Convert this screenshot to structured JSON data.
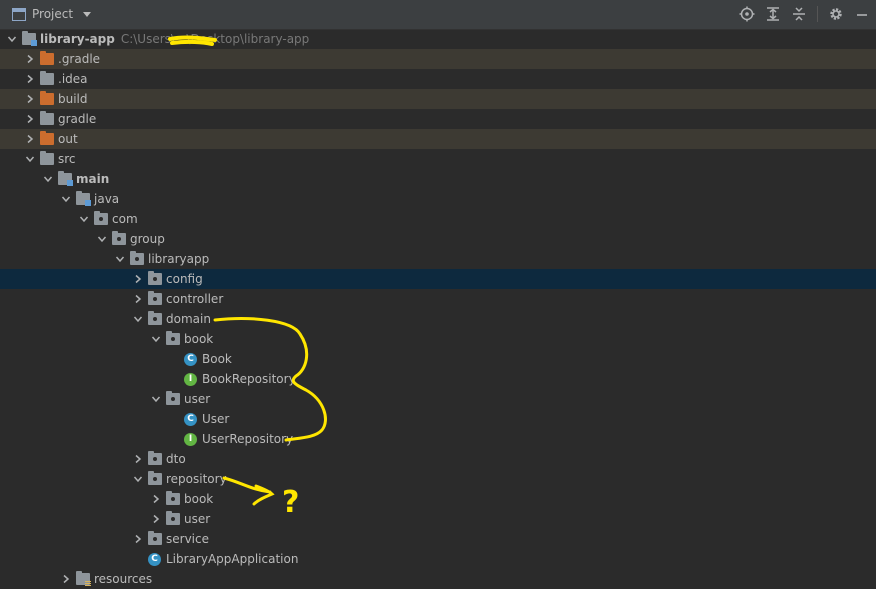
{
  "toolbar": {
    "title": "Project",
    "icons": [
      "locate-icon",
      "expand-all-icon",
      "collapse-all-icon",
      "gear-icon",
      "minimize-icon"
    ]
  },
  "tree": [
    {
      "label": "library-app",
      "path": "C:\\Users\\...\\Desktop\\library-app",
      "depth": 0,
      "expanded": true,
      "icon": "module-folder",
      "bold": true,
      "bg": "none"
    },
    {
      "label": ".gradle",
      "depth": 1,
      "expanded": false,
      "icon": "folder-orange",
      "bg": "excluded"
    },
    {
      "label": ".idea",
      "depth": 1,
      "expanded": false,
      "icon": "folder",
      "bg": "none"
    },
    {
      "label": "build",
      "depth": 1,
      "expanded": false,
      "icon": "folder-orange",
      "bg": "excluded"
    },
    {
      "label": "gradle",
      "depth": 1,
      "expanded": false,
      "icon": "folder",
      "bg": "none"
    },
    {
      "label": "out",
      "depth": 1,
      "expanded": false,
      "icon": "folder-orange",
      "bg": "excluded"
    },
    {
      "label": "src",
      "depth": 1,
      "expanded": true,
      "icon": "folder",
      "bg": "none"
    },
    {
      "label": "main",
      "depth": 2,
      "expanded": true,
      "icon": "folder-module",
      "bold": true,
      "bg": "none"
    },
    {
      "label": "java",
      "depth": 3,
      "expanded": true,
      "icon": "folder-source",
      "bg": "none"
    },
    {
      "label": "com",
      "depth": 4,
      "expanded": true,
      "icon": "package",
      "bg": "none"
    },
    {
      "label": "group",
      "depth": 5,
      "expanded": true,
      "icon": "package",
      "bg": "none"
    },
    {
      "label": "libraryapp",
      "depth": 6,
      "expanded": true,
      "icon": "package",
      "bg": "none"
    },
    {
      "label": "config",
      "depth": 7,
      "expanded": false,
      "icon": "package",
      "bg": "selected"
    },
    {
      "label": "controller",
      "depth": 7,
      "expanded": false,
      "icon": "package",
      "bg": "none"
    },
    {
      "label": "domain",
      "depth": 7,
      "expanded": true,
      "icon": "package",
      "bg": "none"
    },
    {
      "label": "book",
      "depth": 8,
      "expanded": true,
      "icon": "package",
      "bg": "none"
    },
    {
      "label": "Book",
      "depth": 9,
      "leaf": true,
      "icon": "class",
      "letter": "C",
      "bg": "none"
    },
    {
      "label": "BookRepository",
      "depth": 9,
      "leaf": true,
      "icon": "interface",
      "letter": "I",
      "bg": "none"
    },
    {
      "label": "user",
      "depth": 8,
      "expanded": true,
      "icon": "package",
      "bg": "none"
    },
    {
      "label": "User",
      "depth": 9,
      "leaf": true,
      "icon": "class",
      "letter": "C",
      "bg": "none"
    },
    {
      "label": "UserRepository",
      "depth": 9,
      "leaf": true,
      "icon": "interface",
      "letter": "I",
      "bg": "none"
    },
    {
      "label": "dto",
      "depth": 7,
      "expanded": false,
      "icon": "package",
      "bg": "none"
    },
    {
      "label": "repository",
      "depth": 7,
      "expanded": true,
      "icon": "package",
      "bg": "none"
    },
    {
      "label": "book",
      "depth": 8,
      "expanded": false,
      "icon": "package",
      "bg": "none"
    },
    {
      "label": "user",
      "depth": 8,
      "expanded": false,
      "icon": "package",
      "bg": "none"
    },
    {
      "label": "service",
      "depth": 7,
      "expanded": false,
      "icon": "package",
      "bg": "none"
    },
    {
      "label": "LibraryAppApplication",
      "depth": 7,
      "leaf": true,
      "icon": "class-main",
      "letter": "C",
      "bg": "none"
    },
    {
      "label": "resources",
      "depth": 3,
      "expanded": false,
      "icon": "folder-resources",
      "bg": "none"
    }
  ],
  "annotation": {
    "question_mark": "?",
    "color": "#ffe600"
  },
  "colors": {
    "background": "#2b2b2b",
    "toolbar": "#3c3f41",
    "selected_row": "#0d293e",
    "excluded_row": "#3d3a33",
    "excluded_folder": "#cc6d2e",
    "class_icon": "#3592c4",
    "interface_icon": "#62b543"
  }
}
